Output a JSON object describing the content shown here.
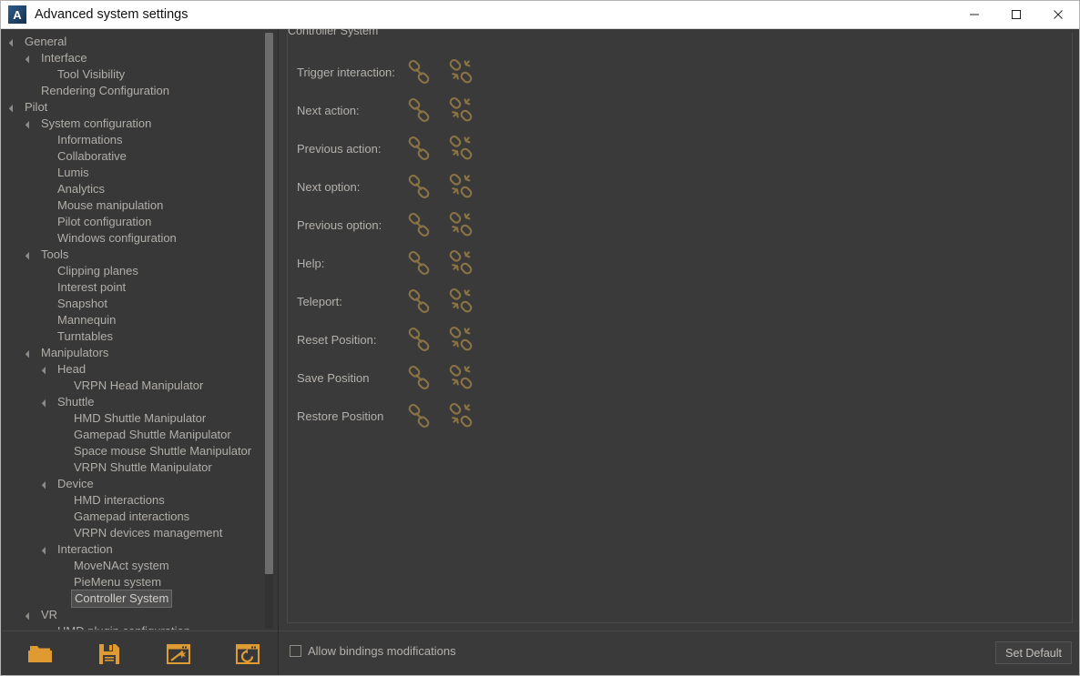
{
  "window": {
    "title": "Advanced system settings",
    "app_icon": "autodesk-a-icon",
    "controls": {
      "minimize": "minimize-icon",
      "maximize": "maximize-icon",
      "close": "close-icon"
    }
  },
  "colors": {
    "window_bg": "#3a3a3a",
    "panel_bg": "#383838",
    "text": "#b4b1ad",
    "accent_orange": "#e09a32",
    "icon_bronze": "#8a7344",
    "selection_bg": "#4e4e4e",
    "titlebar_bg": "#ffffff",
    "titlebar_text": "#111111"
  },
  "tree": {
    "items": [
      {
        "label": "General",
        "depth": 0,
        "twisty": true,
        "selected": false
      },
      {
        "label": "Interface",
        "depth": 1,
        "twisty": true,
        "selected": false
      },
      {
        "label": "Tool Visibility",
        "depth": 2,
        "twisty": false,
        "selected": false
      },
      {
        "label": "Rendering Configuration",
        "depth": 1,
        "twisty": false,
        "selected": false
      },
      {
        "label": "Pilot",
        "depth": 0,
        "twisty": true,
        "selected": false
      },
      {
        "label": "System configuration",
        "depth": 1,
        "twisty": true,
        "selected": false
      },
      {
        "label": "Informations",
        "depth": 2,
        "twisty": false,
        "selected": false
      },
      {
        "label": "Collaborative",
        "depth": 2,
        "twisty": false,
        "selected": false
      },
      {
        "label": "Lumis",
        "depth": 2,
        "twisty": false,
        "selected": false
      },
      {
        "label": "Analytics",
        "depth": 2,
        "twisty": false,
        "selected": false
      },
      {
        "label": "Mouse manipulation",
        "depth": 2,
        "twisty": false,
        "selected": false
      },
      {
        "label": "Pilot configuration",
        "depth": 2,
        "twisty": false,
        "selected": false
      },
      {
        "label": "Windows configuration",
        "depth": 2,
        "twisty": false,
        "selected": false
      },
      {
        "label": "Tools",
        "depth": 1,
        "twisty": true,
        "selected": false
      },
      {
        "label": "Clipping planes",
        "depth": 2,
        "twisty": false,
        "selected": false
      },
      {
        "label": "Interest point",
        "depth": 2,
        "twisty": false,
        "selected": false
      },
      {
        "label": "Snapshot",
        "depth": 2,
        "twisty": false,
        "selected": false
      },
      {
        "label": "Mannequin",
        "depth": 2,
        "twisty": false,
        "selected": false
      },
      {
        "label": "Turntables",
        "depth": 2,
        "twisty": false,
        "selected": false
      },
      {
        "label": "Manipulators",
        "depth": 1,
        "twisty": true,
        "selected": false
      },
      {
        "label": "Head",
        "depth": 2,
        "twisty": true,
        "selected": false
      },
      {
        "label": "VRPN Head Manipulator",
        "depth": 3,
        "twisty": false,
        "selected": false
      },
      {
        "label": "Shuttle",
        "depth": 2,
        "twisty": true,
        "selected": false
      },
      {
        "label": "HMD Shuttle Manipulator",
        "depth": 3,
        "twisty": false,
        "selected": false
      },
      {
        "label": "Gamepad Shuttle Manipulator",
        "depth": 3,
        "twisty": false,
        "selected": false
      },
      {
        "label": "Space mouse Shuttle Manipulator",
        "depth": 3,
        "twisty": false,
        "selected": false
      },
      {
        "label": "VRPN Shuttle Manipulator",
        "depth": 3,
        "twisty": false,
        "selected": false
      },
      {
        "label": "Device",
        "depth": 2,
        "twisty": true,
        "selected": false
      },
      {
        "label": "HMD interactions",
        "depth": 3,
        "twisty": false,
        "selected": false
      },
      {
        "label": "Gamepad interactions",
        "depth": 3,
        "twisty": false,
        "selected": false
      },
      {
        "label": "VRPN devices management",
        "depth": 3,
        "twisty": false,
        "selected": false
      },
      {
        "label": "Interaction",
        "depth": 2,
        "twisty": true,
        "selected": false
      },
      {
        "label": "MoveNAct system",
        "depth": 3,
        "twisty": false,
        "selected": false
      },
      {
        "label": "PieMenu system",
        "depth": 3,
        "twisty": false,
        "selected": false
      },
      {
        "label": "Controller System",
        "depth": 3,
        "twisty": false,
        "selected": true
      },
      {
        "label": "VR",
        "depth": 1,
        "twisty": true,
        "selected": false
      },
      {
        "label": "HMD plugin configuration",
        "depth": 2,
        "twisty": false,
        "selected": false
      }
    ]
  },
  "toolbar": {
    "buttons": [
      {
        "name": "open-folder-icon",
        "tooltip": "Open"
      },
      {
        "name": "save-floppy-icon",
        "tooltip": "Save"
      },
      {
        "name": "magic-wand-window-icon",
        "tooltip": "Apply"
      },
      {
        "name": "reload-window-icon",
        "tooltip": "Reload"
      }
    ]
  },
  "content": {
    "group_title": "Controller System",
    "bindings": [
      {
        "label": "Trigger interaction:",
        "link_icon": "link-icon",
        "unlink_icon": "broken-link-icon"
      },
      {
        "label": "Next action:",
        "link_icon": "link-icon",
        "unlink_icon": "broken-link-icon"
      },
      {
        "label": "Previous action:",
        "link_icon": "link-icon",
        "unlink_icon": "broken-link-icon"
      },
      {
        "label": "Next option:",
        "link_icon": "link-icon",
        "unlink_icon": "broken-link-icon"
      },
      {
        "label": "Previous option:",
        "link_icon": "link-icon",
        "unlink_icon": "broken-link-icon"
      },
      {
        "label": "Help:",
        "link_icon": "link-icon",
        "unlink_icon": "broken-link-icon"
      },
      {
        "label": "Teleport:",
        "link_icon": "link-icon",
        "unlink_icon": "broken-link-icon"
      },
      {
        "label": "Reset Position:",
        "link_icon": "link-icon",
        "unlink_icon": "broken-link-icon"
      },
      {
        "label": "Save Position",
        "link_icon": "link-icon",
        "unlink_icon": "broken-link-icon"
      },
      {
        "label": "Restore Position",
        "link_icon": "link-icon",
        "unlink_icon": "broken-link-icon"
      }
    ]
  },
  "footer": {
    "allow_checkbox_label": "Allow bindings modifications",
    "allow_checkbox_checked": false,
    "set_default_label": "Set Default"
  }
}
